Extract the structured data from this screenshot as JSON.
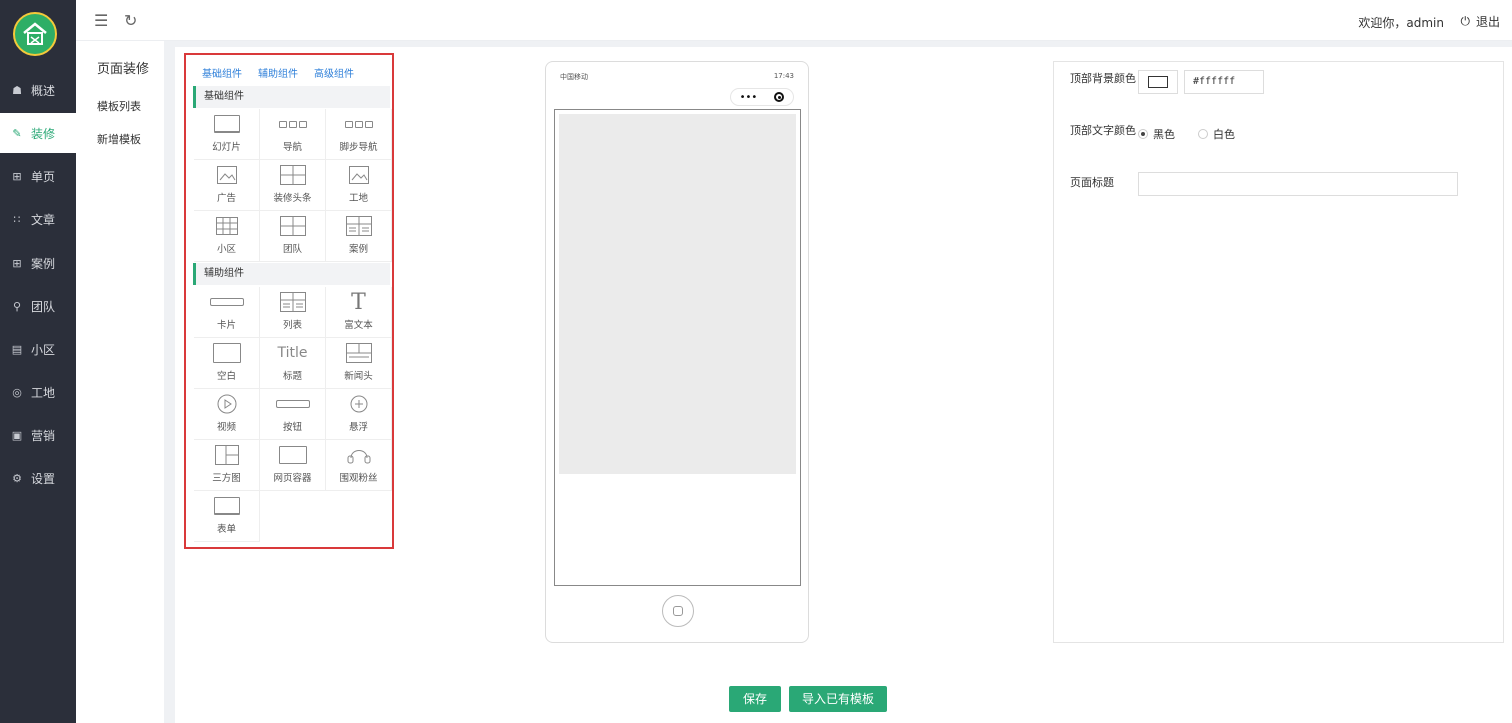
{
  "app": {
    "logo_text": ""
  },
  "sidebar": {
    "items": [
      {
        "label": "概述",
        "icon": "home-icon"
      },
      {
        "label": "装修",
        "icon": "brush-icon",
        "active": true
      },
      {
        "label": "单页",
        "icon": "page-icon"
      },
      {
        "label": "文章",
        "icon": "grid-icon"
      },
      {
        "label": "案例",
        "icon": "case-icon"
      },
      {
        "label": "团队",
        "icon": "user-icon"
      },
      {
        "label": "小区",
        "icon": "building-icon"
      },
      {
        "label": "工地",
        "icon": "location-icon"
      },
      {
        "label": "营销",
        "icon": "marketing-icon"
      },
      {
        "label": "设置",
        "icon": "settings-icon"
      }
    ]
  },
  "topbar": {
    "welcome": "欢迎你，admin",
    "logout": "退出"
  },
  "submenu": {
    "title": "页面装修",
    "items": [
      "模板列表",
      "新增模板"
    ]
  },
  "library": {
    "tabs": [
      "基础组件",
      "辅助组件",
      "高级组件"
    ],
    "sections": [
      {
        "title": "基础组件",
        "items": [
          "幻灯片",
          "导航",
          "脚步导航",
          "广告",
          "装修头条",
          "工地",
          "小区",
          "团队",
          "案例"
        ]
      },
      {
        "title": "辅助组件",
        "items": [
          "卡片",
          "列表",
          "富文本",
          "空白",
          "标题",
          "新闻头",
          "视频",
          "按钮",
          "悬浮",
          "三方图",
          "网页容器",
          "围观粉丝",
          "表单"
        ]
      }
    ],
    "title_glyph": "Title",
    "text_glyph": "T"
  },
  "phone": {
    "carrier": "中国移动",
    "status": "17:43",
    "capsule_menu": "•••"
  },
  "settings": {
    "bg_color_label": "顶部背景颜色",
    "bg_color_value": "#ffffff",
    "text_color_label": "顶部文字颜色",
    "text_color_options": [
      "黑色",
      "白色"
    ],
    "text_color_selected": "黑色",
    "page_title_label": "页面标题",
    "page_title_value": ""
  },
  "actions": {
    "save": "保存",
    "import": "导入已有模板"
  },
  "colors": {
    "accent": "#2aa876",
    "sidebar_bg": "#2b2f3a",
    "highlight_border": "#d9393a",
    "link": "#2e7fd9"
  }
}
